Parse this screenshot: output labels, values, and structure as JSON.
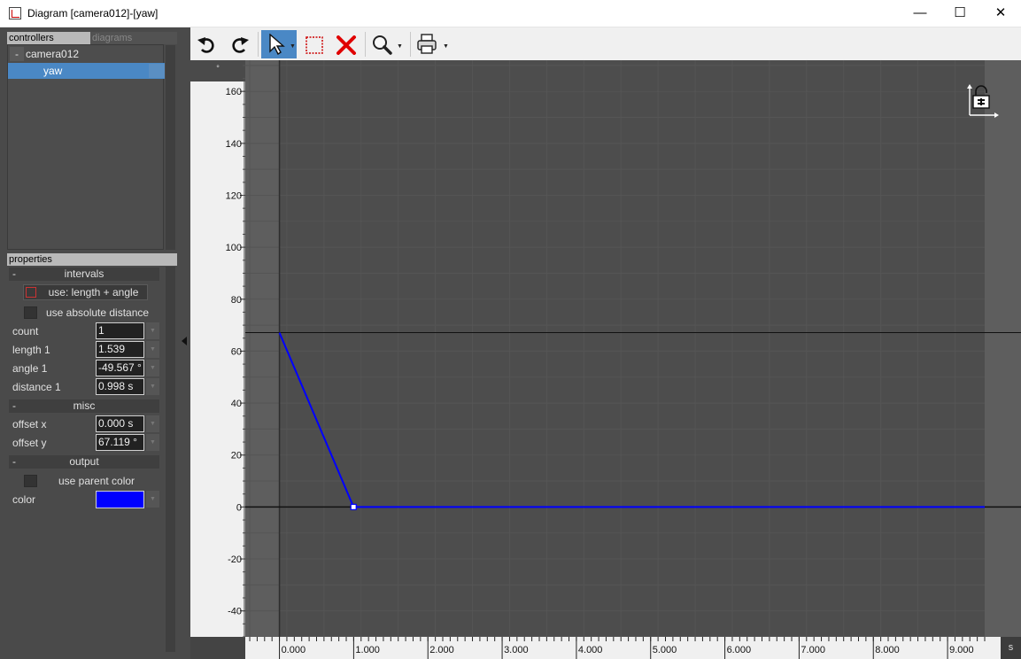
{
  "window": {
    "title": "Diagram [camera012]-[yaw]",
    "minimize": "—",
    "maximize": "☐",
    "close": "✕"
  },
  "left": {
    "tabs": [
      "controllers",
      "diagrams"
    ],
    "tree": {
      "parent_toggle": "-",
      "parent": "camera012",
      "child": "yaw"
    },
    "properties_header": "properties",
    "intervals": {
      "header": "intervals",
      "toggle": "-",
      "mode_button": "use: length + angle",
      "use_absolute_distance": "use absolute distance",
      "count_label": "count",
      "count": "1",
      "length_label": "length 1",
      "length": "1.539",
      "angle_label": "angle 1",
      "angle": "-49.567 °",
      "distance_label": "distance 1",
      "distance": "0.998 s"
    },
    "misc": {
      "header": "misc",
      "toggle": "-",
      "offset_x_label": "offset x",
      "offset_x": "0.000 s",
      "offset_y_label": "offset y",
      "offset_y": "67.119 °"
    },
    "output": {
      "header": "output",
      "toggle": "-",
      "use_parent_color": "use parent color",
      "color_label": "color",
      "color": "#0000ff"
    }
  },
  "toolbar": {
    "icons": [
      "undo-icon",
      "redo-icon",
      "select-arrow-icon",
      "rectangle-select-icon",
      "delete-icon",
      "zoom-icon",
      "print-icon"
    ]
  },
  "chart_data": {
    "type": "line",
    "yunit": "°",
    "xunit": "s",
    "y_ticks": [
      160,
      140,
      120,
      100,
      80,
      60,
      40,
      20,
      0,
      -20,
      -40
    ],
    "x_ticks": [
      "0.000",
      "1.000",
      "2.000",
      "3.000",
      "4.000",
      "5.000",
      "6.000",
      "7.000",
      "8.000",
      "9.000"
    ],
    "xlim": [
      -0.46,
      9.5
    ],
    "ylim": [
      -50,
      172
    ],
    "reference_line_y": 67.119,
    "series": [
      {
        "color": "#0000ff",
        "x": [
          0.0,
          0.998,
          9.5
        ],
        "y": [
          67.119,
          0,
          0
        ]
      }
    ],
    "selected_point": {
      "x": 0.998,
      "y": 0
    }
  }
}
